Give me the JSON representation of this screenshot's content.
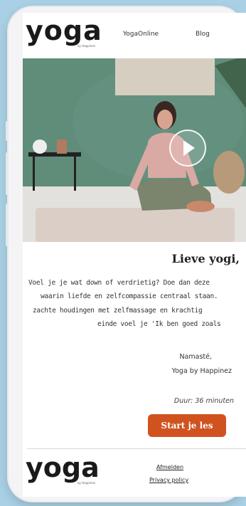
{
  "header": {
    "logo": "yoga",
    "logo_sub": "by Happinez",
    "nav": [
      "YogaOnline",
      "Blog"
    ]
  },
  "hero": {
    "video_play": "play-button"
  },
  "content": {
    "greeting": "Lieve yogi,",
    "lines": [
      "Voel je je wat down of verdrietig? Doe dan deze",
      "waarin liefde en zelfcompassie centraal staan.",
      "zachte houdingen met zelfmassage en krachtig",
      "einde voel je 'Ik ben goed zoals"
    ],
    "sign_off": [
      "Namasté,",
      "Yoga by Happinez"
    ],
    "duration": "Duur: 36 minuten",
    "cta_label": "Start je les"
  },
  "footer": {
    "logo": "yoga",
    "logo_sub": "by Happinez",
    "links": [
      "Afmelden",
      "Privacy policy"
    ]
  },
  "colors": {
    "background": "#a9d0e4",
    "accent": "#d0531f",
    "wall": "#5d8b78"
  }
}
